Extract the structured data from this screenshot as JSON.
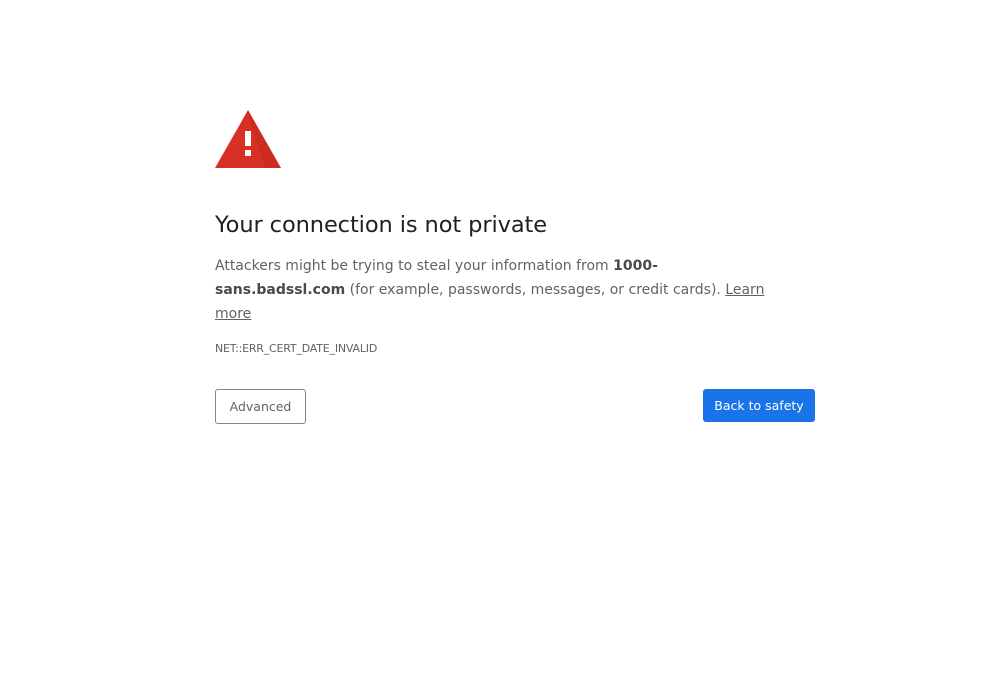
{
  "icon": {
    "name": "warning-icon",
    "color": "#d93025",
    "mark_color": "#ffffff"
  },
  "interstitial": {
    "title": "Your connection is not private",
    "message_prefix": "Attackers might be trying to steal your information from ",
    "host": "1000-sans.badssl.com",
    "message_suffix": " (for example, passwords, messages, or credit cards). ",
    "learn_more": "Learn more",
    "error_code": "NET::ERR_CERT_DATE_INVALID"
  },
  "buttons": {
    "advanced_label": "Advanced",
    "back_label": "Back to safety",
    "primary_color": "#1a73e8"
  }
}
